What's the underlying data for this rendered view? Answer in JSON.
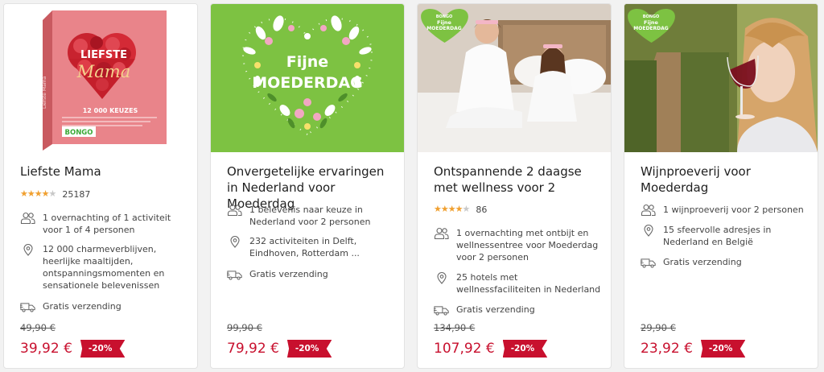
{
  "products": [
    {
      "title": "Liefste Mama",
      "rating": {
        "stars": 4,
        "count": "25187"
      },
      "features": [
        {
          "icon": "people-icon",
          "text": "1 overnachting of 1 activiteit voor 1 of 4 personen"
        },
        {
          "icon": "location-icon",
          "text": "12 000 charmeverblijven, heerlijke maaltijden, ontspanningsmomenten en sensationele belevenissen"
        },
        {
          "icon": "truck-icon",
          "text": "Gratis verzending"
        }
      ],
      "old_price": "49,90 €",
      "price": "39,92 €",
      "discount": "-20%",
      "image": {
        "box_title": "LIEFSTE",
        "box_script": "Mama",
        "box_count": "12 000 KEUZES",
        "brand": "BONGO",
        "side_text": "Liefste Mama"
      }
    },
    {
      "title": "Onvergetelijke ervaringen in Nederland voor Moederdag",
      "features": [
        {
          "icon": "people-icon",
          "text": "1 belevenis naar keuze in Nederland voor 2 personen"
        },
        {
          "icon": "location-icon",
          "text": "232 activiteiten in Delft, Eindhoven, Rotterdam ..."
        },
        {
          "icon": "truck-icon",
          "text": "Gratis verzending"
        }
      ],
      "old_price": "99,90 €",
      "price": "79,92 €",
      "discount": "-20%",
      "image": {
        "line1": "Fijne",
        "line2": "MOEDERDAG"
      }
    },
    {
      "title": "Ontspannende 2 daagse met wellness voor 2",
      "rating": {
        "stars": 4,
        "count": "86"
      },
      "features": [
        {
          "icon": "people-icon",
          "text": "1 overnachting met ontbijt en wellnessentree voor Moederdag voor 2 personen"
        },
        {
          "icon": "location-icon",
          "text": "25 hotels met wellnessfaciliteiten in Nederland"
        },
        {
          "icon": "truck-icon",
          "text": "Gratis verzending"
        }
      ],
      "old_price": "134,90 €",
      "price": "107,92 €",
      "discount": "-20%",
      "image": {
        "brand": "BONGO",
        "line1": "Fijne",
        "line2": "MOEDERDAG"
      }
    },
    {
      "title": "Wijnproeverij voor Moederdag",
      "features": [
        {
          "icon": "people-icon",
          "text": "1 wijnproeverij voor 2 personen"
        },
        {
          "icon": "location-icon",
          "text": "15 sfeervolle adresjes in Nederland en België"
        },
        {
          "icon": "truck-icon",
          "text": "Gratis verzending"
        }
      ],
      "old_price": "29,90 €",
      "price": "23,92 €",
      "discount": "-20%",
      "image": {
        "brand": "BONGO",
        "line1": "Fijne",
        "line2": "MOEDERDAG"
      }
    }
  ],
  "colors": {
    "price_red": "#c8102e",
    "star": "#f0a030",
    "moederdag_green": "#7dc242",
    "pink_box": "#e87a80"
  }
}
